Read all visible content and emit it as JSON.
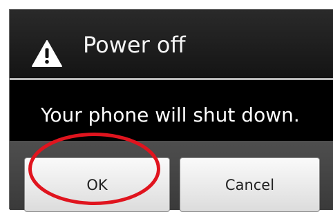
{
  "dialog": {
    "title": "Power off",
    "message": "Your phone will shut down.",
    "icon": "warning-icon"
  },
  "buttons": {
    "ok_label": "OK",
    "cancel_label": "Cancel"
  },
  "annotation": {
    "type": "circle",
    "target": "ok-button",
    "color": "#e0141e"
  },
  "colors": {
    "dialog_background": "#000000",
    "title_text": "#f4f4f4",
    "divider": "#b8b8b8",
    "button_bar": "#444444",
    "button_face": "#eeeeee"
  }
}
